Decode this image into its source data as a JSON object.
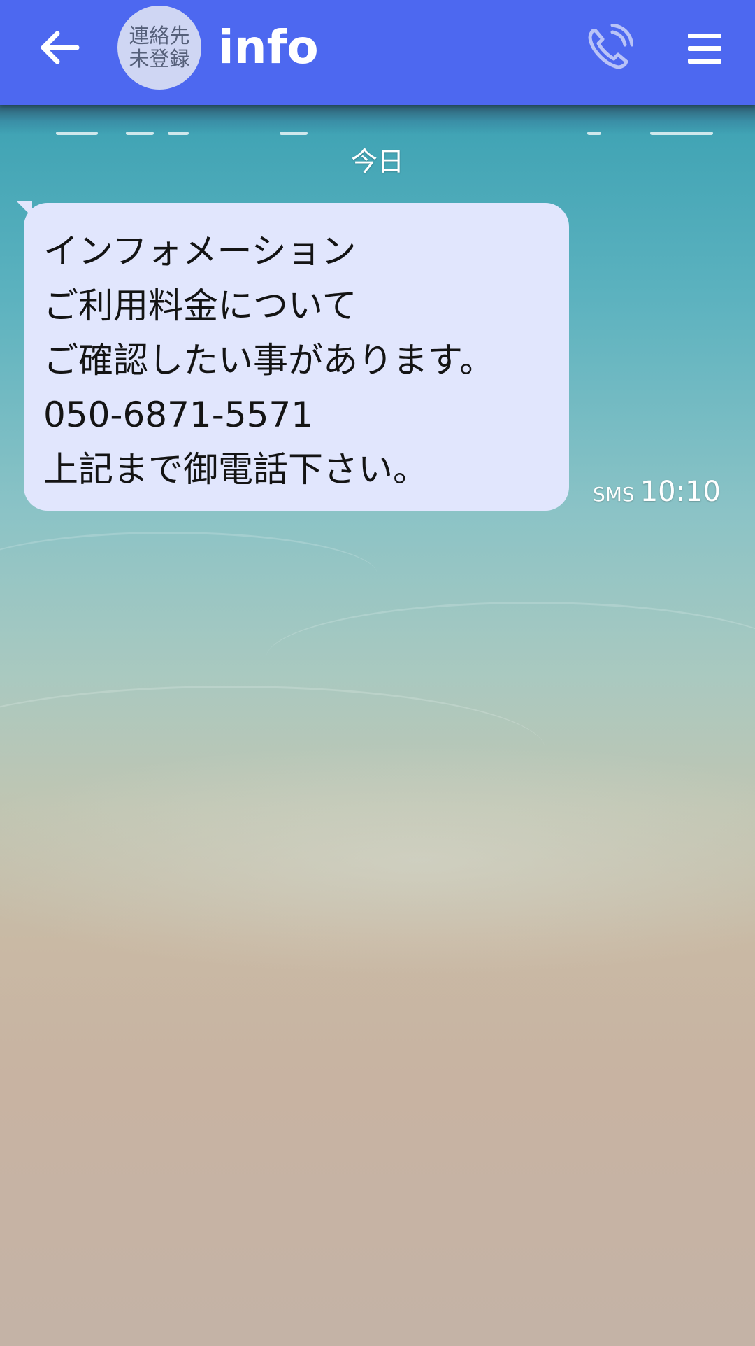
{
  "header": {
    "back_icon": "arrow-left-icon",
    "avatar_text": "連絡先\n未登録",
    "title": "info",
    "call_icon": "phone-call-icon",
    "menu_icon": "hamburger-menu-icon",
    "background_color": "#4d68f0"
  },
  "conversation": {
    "date_label": "今日",
    "messages": [
      {
        "lines": [
          "インフォメーション",
          "ご利用料金について",
          "ご確認したい事があります。",
          "050-6871-5571",
          "上記まで御電話下さい。"
        ],
        "type_label": "SMS",
        "time": "10:10",
        "bubble_color": "#e1e6fd"
      }
    ]
  }
}
